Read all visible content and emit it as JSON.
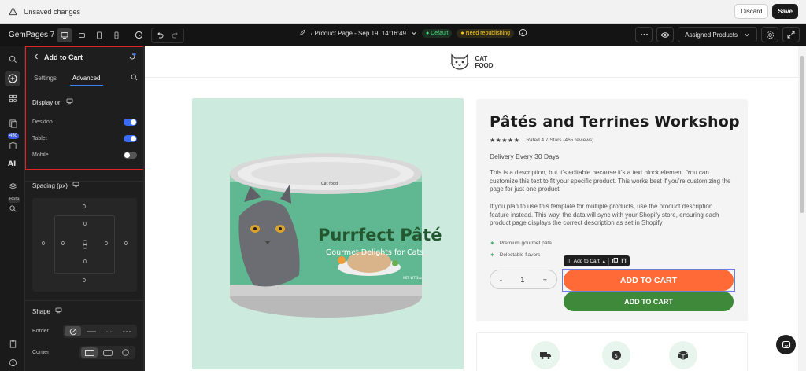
{
  "unsaved_bar": {
    "label": "Unsaved changes",
    "discard_label": "Discard",
    "save_label": "Save"
  },
  "topbar": {
    "brand": "GemPages 7",
    "page_title": "/ Product Page - Sep 19, 14:16:49",
    "status_default": "Default",
    "status_republish": "Need republishing",
    "assigned_label": "Assigned Products"
  },
  "rail": {
    "badge_count": "450",
    "beta_label": "Beta"
  },
  "panel": {
    "title": "Add to Cart",
    "tabs": [
      "Settings",
      "Advanced"
    ],
    "active_tab": "Advanced",
    "display_on": {
      "title": "Display on",
      "items": [
        {
          "label": "Desktop",
          "enabled": true
        },
        {
          "label": "Tablet",
          "enabled": true
        },
        {
          "label": "Mobile",
          "enabled": false
        }
      ]
    },
    "spacing": {
      "title": "Spacing (px)",
      "margin_top": "0",
      "margin_left": "0",
      "margin_right": "0",
      "margin_bottom": "0",
      "padding_top": "0",
      "padding_left": "0",
      "padding_right": "0",
      "padding_bottom": "0"
    },
    "shape": {
      "title": "Shape",
      "border_label": "Border",
      "corner_label": "Corner"
    }
  },
  "store": {
    "logo_line1": "CAT",
    "logo_line2": "FOOD"
  },
  "product": {
    "title": "Pâtés and Terrines Workshop",
    "stars": "★★★★★",
    "rating_text": "Rated 4.7 Stars (465 reviews)",
    "delivery": "Delivery Every 30 Days",
    "desc1": "This is a description, but it's editable because it's a text block element. You can customize this text to fit your specific product. This works best if you're customizing the page for just one product.",
    "desc2": "If you plan to use this template for multiple products, use the product description feature instead. This way, the data will sync with your Shopify store, ensuring each product page displays the correct description as set in Shopify",
    "features": [
      "Premium gourmet pâté",
      "Delectable flavors"
    ],
    "qty_minus": "-",
    "qty_value": "1",
    "qty_plus": "+",
    "atc_toolbar_label": "Add to Cart",
    "add_to_cart_primary": "ADD TO CART",
    "add_to_cart_secondary": "ADD TO CART",
    "can": {
      "brand": "Cat food",
      "name": "Purrfect Pâté",
      "tagline": "Gourmet Delights for Cats",
      "net_weight": "NET WT 3oz"
    }
  },
  "colors": {
    "accent": "#3b6cf5",
    "add_to_cart": "#ff6a36",
    "add_to_cart_2": "#3f8a3a",
    "highlight": "#e02424",
    "product_bg": "#ccebde"
  }
}
